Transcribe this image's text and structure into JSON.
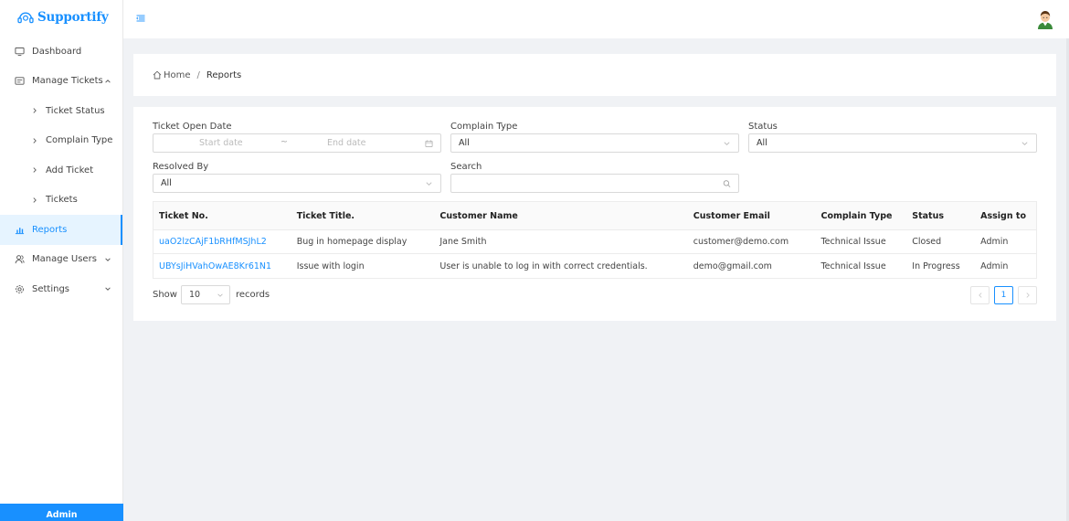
{
  "app": {
    "name": "Supportify"
  },
  "colors": {
    "accent": "#1890ff",
    "active_bg": "#e6f4ff"
  },
  "sidebar": {
    "items": [
      {
        "label": "Dashboard",
        "icon": "monitor-icon"
      },
      {
        "label": "Manage Tickets",
        "icon": "ticket-icon",
        "expanded": true
      },
      {
        "label": "Ticket Status",
        "icon": "chevron-right-icon"
      },
      {
        "label": "Complain Type",
        "icon": "chevron-right-icon"
      },
      {
        "label": "Add Ticket",
        "icon": "chevron-right-icon"
      },
      {
        "label": "Tickets",
        "icon": "chevron-right-icon"
      },
      {
        "label": "Reports",
        "icon": "bar-chart-icon",
        "active": true
      },
      {
        "label": "Manage Users",
        "icon": "users-icon"
      },
      {
        "label": "Settings",
        "icon": "settings-icon"
      }
    ],
    "footer_label": "Admin"
  },
  "breadcrumb": {
    "home": "Home",
    "separator": "/",
    "current": "Reports"
  },
  "filters": {
    "open_date": {
      "label": "Ticket Open Date",
      "start_placeholder": "Start date",
      "separator": "~",
      "end_placeholder": "End date"
    },
    "complain_type": {
      "label": "Complain Type",
      "value": "All"
    },
    "status": {
      "label": "Status",
      "value": "All"
    },
    "resolved_by": {
      "label": "Resolved By",
      "value": "All"
    },
    "search": {
      "label": "Search",
      "value": ""
    }
  },
  "table": {
    "columns": [
      "Ticket No.",
      "Ticket Title.",
      "Customer Name",
      "Customer Email",
      "Complain Type",
      "Status",
      "Assign to"
    ],
    "rows": [
      [
        "uaO2lzCAjF1bRHfMSJhL2",
        "Bug in homepage display",
        "Jane Smith",
        "customer@demo.com",
        "Technical Issue",
        "Closed",
        "Admin"
      ],
      [
        "UBYsJiHVahOwAE8Kr61N1",
        "Issue with login",
        "User is unable to log in with correct credentials.",
        "demo@gmail.com",
        "Technical Issue",
        "In Progress",
        "Admin"
      ]
    ]
  },
  "pagination": {
    "show_label": "Show",
    "page_size": "10",
    "records_label": "records",
    "current_page": "1"
  }
}
